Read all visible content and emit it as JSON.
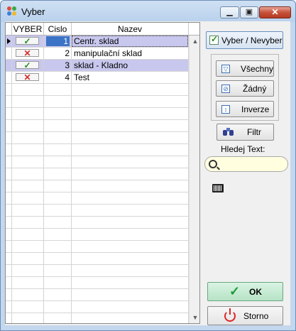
{
  "window": {
    "title": "Vyber"
  },
  "grid": {
    "columns": [
      "VYBER",
      "Cislo",
      "Nazev"
    ],
    "rows": [
      {
        "selected": true,
        "cislo": "1",
        "nazev": "Centr. sklad"
      },
      {
        "selected": false,
        "cislo": "2",
        "nazev": "manipulační sklad"
      },
      {
        "selected": true,
        "cislo": "3",
        "nazev": "sklad - Kladno"
      },
      {
        "selected": false,
        "cislo": "4",
        "nazev": "Test"
      }
    ]
  },
  "panel": {
    "toggle_label": "Vyber / Nevyber",
    "all_label": "Všechny",
    "none_label": "Žádný",
    "invert_label": "Inverze",
    "filter_label": "Filtr",
    "search_label": "Hledej Text:",
    "search_value": "",
    "ok_label": "OK",
    "cancel_label": "Storno"
  },
  "colors": {
    "row_highlight": "#c8c7ee",
    "selected_cell": "#3b74c6"
  }
}
